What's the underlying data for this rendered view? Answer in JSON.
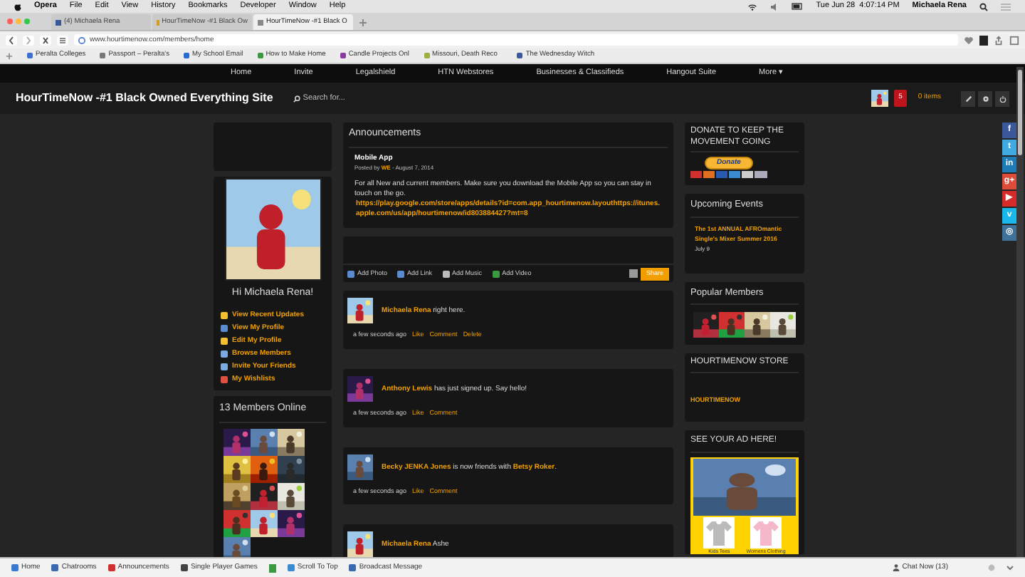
{
  "menu_bar": {
    "app": "Opera",
    "items": [
      "File",
      "Edit",
      "View",
      "History",
      "Bookmarks",
      "Developer",
      "Window",
      "Help"
    ],
    "clock": "Tue Jun 28  4:07:14 PM",
    "user": "Michaela Rena"
  },
  "tabs": [
    {
      "label": "(4) Michaela Rena",
      "selected": false
    },
    {
      "label": "HourTimeNow -#1 Black Ow",
      "selected": false
    },
    {
      "label": "HourTimeNow -#1 Black O",
      "selected": true
    }
  ],
  "address": "www.hourtimenow.com/members/home",
  "bookmarks": [
    "Peralta Colleges",
    "Passport – Peralta's",
    "My School Email",
    "How to Make Home",
    "Candle Projects Onl",
    "Missouri, Death Reco",
    "The Wednesday Witch"
  ],
  "nav": [
    "Home",
    "Invite",
    "Legalshield",
    "HTN Webstores",
    "Businesses & Classifieds",
    "Hangout Suite",
    "More ▾"
  ],
  "header": {
    "title": "HourTimeNow -#1 Black Owned Everything Site",
    "search_placeholder": "Search for...",
    "notifications": "5",
    "cart": "0 items"
  },
  "sidebar": {
    "profile_photo": {
      "kind": "picture"
    },
    "greeting": "Hi Michaela Rena!",
    "links": [
      "View Recent Updates",
      "View My Profile",
      "Edit My Profile",
      "Browse Members",
      "Invite Your Friends",
      "My Wishlists"
    ],
    "members_online": {
      "title": "13 Members Online",
      "avatars": [
        {
          "kind": "picture"
        },
        {
          "kind": "picture"
        },
        {
          "kind": "picture"
        },
        {
          "kind": "picture"
        },
        {
          "kind": "picture"
        },
        {
          "kind": "picture"
        },
        {
          "kind": "picture"
        },
        {
          "kind": "picture"
        },
        {
          "kind": "picture"
        },
        {
          "kind": "picture"
        },
        {
          "kind": "picture"
        },
        {
          "kind": "picture"
        },
        {
          "kind": "picture"
        }
      ]
    }
  },
  "announcements": {
    "title": "Announcements",
    "post_title": "Mobile App",
    "byline": [
      {
        "kind": "plain",
        "text": "Posted by "
      },
      {
        "kind": "link",
        "text": "WE"
      },
      {
        "kind": "plain",
        "text": " - August 7, 2014"
      }
    ],
    "body": "For all New and current members. Make sure you download the Mobile App so you can stay in touch on the go.",
    "link": "https://play.google.com/store/apps/details?id=com.app_hourtimenow.layouthttps://itunes.apple.com/us/app/hourtimenow/id803884427?mt=8"
  },
  "composer": {
    "actions": [
      "Add Photo",
      "Add Link",
      "Add Music",
      "Add Video"
    ],
    "button": "Share"
  },
  "feed": [
    {
      "segments": [
        {
          "kind": "link",
          "text": "Michaela Rena"
        },
        {
          "kind": "plain",
          "text": " right here."
        }
      ],
      "time": "a few seconds ago",
      "actions": [
        "Like",
        "Comment",
        "Delete"
      ]
    },
    {
      "segments": [
        {
          "kind": "link",
          "text": "Anthony Lewis"
        },
        {
          "kind": "plain",
          "text": " has just signed up. Say hello!"
        }
      ],
      "time": "a few seconds ago",
      "actions": [
        "Like",
        "Comment"
      ]
    },
    {
      "segments": [
        {
          "kind": "link",
          "text": "Becky JENKA Jones"
        },
        {
          "kind": "plain",
          "text": " is now friends with "
        },
        {
          "kind": "link",
          "text": "Betsy Roker"
        },
        {
          "kind": "plain",
          "text": "."
        }
      ],
      "time": "a few seconds ago",
      "actions": [
        "Like",
        "Comment"
      ]
    },
    {
      "segments": [
        {
          "kind": "link",
          "text": "Michaela Rena"
        },
        {
          "kind": "plain",
          "text": " Ashe"
        }
      ]
    }
  ],
  "right": {
    "donate_title": "DONATE TO KEEP THE MOVEMENT GOING",
    "donate_button": "Donate",
    "events_title": "Upcoming Events",
    "event": "The 1st ANNUAL AFROmantic Single's Mixer Summer 2016",
    "event_date": "July 9",
    "popular_title": "Popular Members",
    "popular": [
      {
        "kind": "picture"
      },
      {
        "kind": "picture"
      },
      {
        "kind": "picture"
      },
      {
        "kind": "picture"
      }
    ],
    "store_title": "HOURTIMENOW STORE",
    "store_link": "HOURTIMENOW",
    "ad_title": "SEE YOUR AD HERE!",
    "ad_labels": [
      "Kids Tees",
      "Womens Clothing"
    ]
  },
  "social": [
    {
      "label": "f",
      "color": "#3b5998"
    },
    {
      "label": "t",
      "color": "#3fa9e0"
    },
    {
      "label": "in",
      "color": "#1f7bb6"
    },
    {
      "label": "g+",
      "color": "#dd4b39"
    },
    {
      "label": "▶",
      "color": "#d62b2b"
    },
    {
      "label": "v",
      "color": "#1ab7ea"
    },
    {
      "label": "◎",
      "color": "#3f729b"
    }
  ],
  "bottom_bar": {
    "items": [
      "Home",
      "Chatrooms",
      "Announcements",
      "Single Player Games",
      "Scroll To Top",
      "Broadcast Message"
    ],
    "chat": "Chat Now (13)"
  }
}
